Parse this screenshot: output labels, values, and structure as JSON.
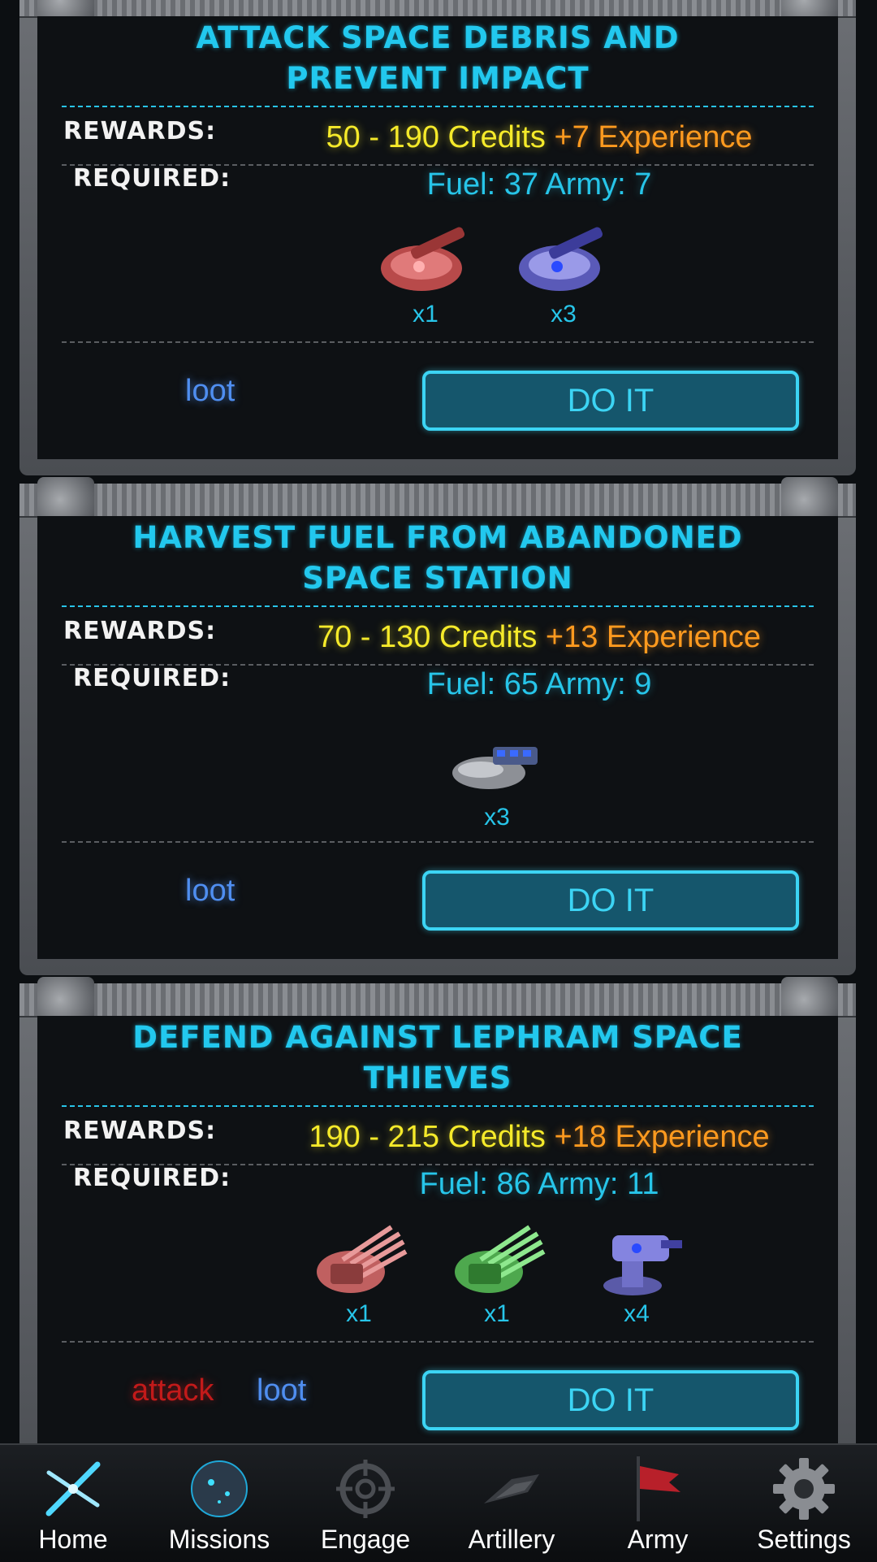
{
  "missions": [
    {
      "title": "ATTACK SPACE DEBRIS AND PREVENT IMPACT",
      "rewards_label": "REWARDS:",
      "required_label": "REQUIRED:",
      "credits": "50 - 190 Credits",
      "experience": "+7 Experience",
      "requirements": "Fuel: 37 Army: 7",
      "units": [
        {
          "icon": "red-fighter-ship-icon",
          "qty": "x1"
        },
        {
          "icon": "blue-fighter-ship-icon",
          "qty": "x3"
        }
      ],
      "tags": [
        "loot"
      ],
      "button": "DO IT"
    },
    {
      "title": "HARVEST FUEL FROM ABANDONED SPACE STATION",
      "rewards_label": "REWARDS:",
      "required_label": "REQUIRED:",
      "credits": "70 - 130 Credits",
      "experience": "+13 Experience",
      "requirements": "Fuel: 65 Army: 9",
      "units": [
        {
          "icon": "gray-cruiser-ship-icon",
          "qty": "x3"
        }
      ],
      "tags": [
        "loot"
      ],
      "button": "DO IT"
    },
    {
      "title": "DEFEND AGAINST LEPHRAM SPACE THIEVES",
      "rewards_label": "REWARDS:",
      "required_label": "REQUIRED:",
      "credits": "190 - 215 Credits",
      "experience": "+18 Experience",
      "requirements": "Fuel: 86 Army: 11",
      "units": [
        {
          "icon": "red-claw-ship-icon",
          "qty": "x1"
        },
        {
          "icon": "green-claw-ship-icon",
          "qty": "x1"
        },
        {
          "icon": "blue-turret-icon",
          "qty": "x4"
        }
      ],
      "tags": [
        "attack",
        "loot"
      ],
      "button": "DO IT"
    }
  ],
  "nav": [
    {
      "label": "Home",
      "icon": "home-x-icon"
    },
    {
      "label": "Missions",
      "icon": "missions-planet-icon"
    },
    {
      "label": "Engage",
      "icon": "engage-crosshair-icon"
    },
    {
      "label": "Artillery",
      "icon": "artillery-ship-icon"
    },
    {
      "label": "Army",
      "icon": "army-flag-icon"
    },
    {
      "label": "Settings",
      "icon": "settings-gear-icon"
    }
  ],
  "colors": {
    "title": "#22c8ee",
    "credits": "#f5ea2a",
    "experience": "#ff9a1f",
    "requirements": "#27c5e9",
    "loot": "#4f8ef0",
    "attack": "#c21a1a",
    "button_bg": "#15566c"
  }
}
